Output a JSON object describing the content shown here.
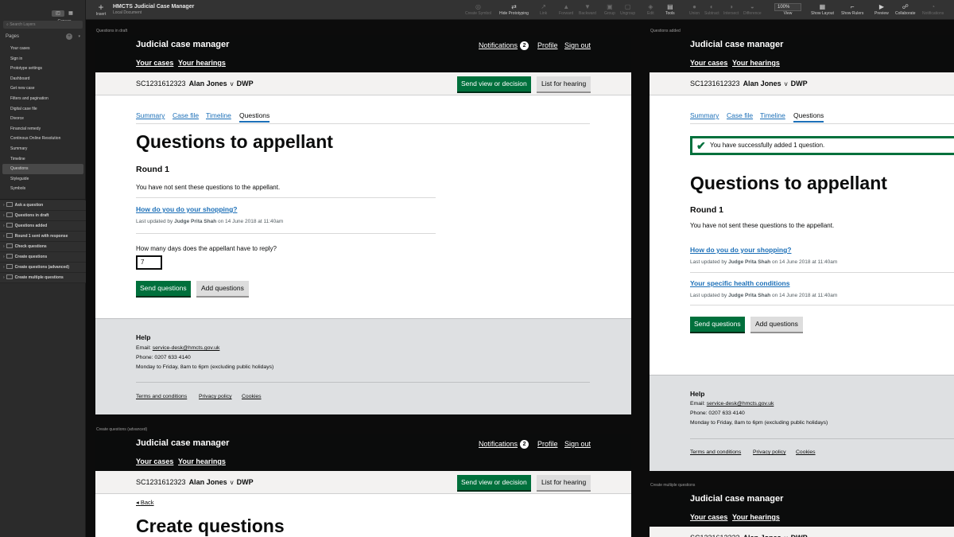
{
  "toolbar": {
    "insert_label": "Insert",
    "doc_title": "HMCTS Judicial Case Manager",
    "doc_subtitle": "Local Document",
    "tools": [
      "Create Symbol",
      "Hide Prototyping",
      "Link",
      "Forward",
      "Backward",
      "Group",
      "Ungroup",
      "Edit",
      "Tools",
      "Union",
      "Subtract",
      "Intersect",
      "Difference",
      "View",
      "Show Layout",
      "Show Rulers",
      "Preview",
      "Collaborate",
      "Notifications"
    ],
    "zoom": "100%"
  },
  "left_panel": {
    "canvas_label": "Canvas",
    "search_placeholder": "Search Layers",
    "pages_label": "Pages",
    "pages": [
      "Your cases",
      "Sign in",
      "Prototype settings",
      "Dashboard",
      "Get new case",
      "Filters and pagination",
      "Digital case file",
      "Divorce",
      "Financial remedy",
      "Continous Online Resolution",
      "Summary",
      "Timeline",
      "Questions",
      "Styleguide",
      "Symbols"
    ],
    "selected_page": "Questions",
    "layers": [
      "Ask a question",
      "Questions in draft",
      "Questions added",
      "Round 1 sent with response",
      "Check questions",
      "Create questions",
      "Create questions (advanced)",
      "Create multiple questions"
    ]
  },
  "site": {
    "brand": "Judicial case manager",
    "notifications_label": "Notifications",
    "notifications_count": "2",
    "profile": "Profile",
    "sign_out": "Sign out",
    "your_cases": "Your cases",
    "your_hearings": "Your hearings",
    "case_ref": "SC1231612323",
    "appellant": "Alan Jones",
    "versus": "v",
    "respondent": "DWP",
    "send_view_btn": "Send view or decision",
    "list_hearing_btn": "List for hearing",
    "tabs": [
      "Summary",
      "Case file",
      "Timeline",
      "Questions"
    ],
    "active_tab": "Questions",
    "page_heading": "Questions to appellant",
    "round": "Round 1",
    "not_sent_text": "You have not sent these questions to the appellant.",
    "updated_prefix": "Last updated by",
    "updated_by": "Judge Prita Shah",
    "updated_suffix": "on 14 June 2018 at 11:40am",
    "days_question": "How many days does the appellant have to reply?",
    "days_value": "7",
    "send_questions_btn": "Send questions",
    "add_questions_btn": "Add questions",
    "success_message": "You have successfully added 1 question.",
    "back": "Back",
    "create_heading": "Create questions"
  },
  "footer": {
    "help": "Help",
    "email_label": "Email:",
    "email": "service-desk@hmcts.gov.uk",
    "phone": "Phone: 0207 633 4140",
    "hours": "Monday to Friday, 8am to 6pm (excluding public holidays)",
    "terms": "Terms and conditions",
    "privacy": "Privacy policy",
    "cookies": "Cookies"
  },
  "artboards": {
    "draft": {
      "label": "Questions in draft",
      "questions": [
        "How do you do your shopping?"
      ]
    },
    "added": {
      "label": "Questions added",
      "questions": [
        "How do you do your shopping?",
        "Your specific health conditions"
      ]
    },
    "advanced": {
      "label": "Create questions (advanced)"
    },
    "multiple": {
      "label": "Create multiple questions"
    }
  }
}
